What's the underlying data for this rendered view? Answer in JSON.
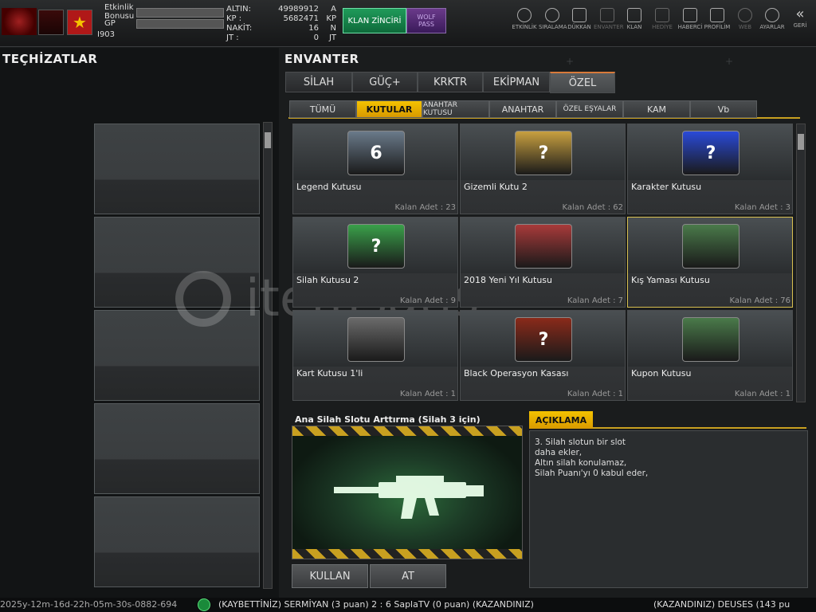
{
  "topbar": {
    "event_bonus": "Etkinlik\nBonusu",
    "gp": "GP",
    "level": "I903",
    "currencies": [
      {
        "label": "ALTIN:",
        "value": "49989912",
        "unit": "A"
      },
      {
        "label": "KP  :",
        "value": "5682471",
        "unit": "KP"
      },
      {
        "label": "NAKİT:",
        "value": "16",
        "unit": "N"
      },
      {
        "label": "JT  :",
        "value": "0",
        "unit": "JT"
      }
    ],
    "klan_button": "KLAN ZİNCİRİ",
    "wolf_pass": [
      "WOLF",
      "PASS"
    ],
    "nav": [
      {
        "label": "ETKİNLİK",
        "icon": "stopwatch-icon",
        "dim": false
      },
      {
        "label": "SIRALAMA",
        "icon": "medal-icon",
        "dim": false
      },
      {
        "label": "DÜKKAN",
        "icon": "cart-icon",
        "dim": false
      },
      {
        "label": "ENVANTER",
        "icon": "inventory-icon",
        "dim": true
      },
      {
        "label": "KLAN",
        "icon": "shield-icon",
        "dim": false
      },
      {
        "label": "HEDİYE",
        "icon": "gift-icon",
        "dim": true
      },
      {
        "label": "HABERCİ",
        "icon": "megaphone-icon",
        "dim": false
      },
      {
        "label": "PROFİLİM",
        "icon": "profile-icon",
        "dim": false
      },
      {
        "label": "WEB",
        "icon": "globe-icon",
        "dim": true
      },
      {
        "label": "AYARLAR",
        "icon": "gear-icon",
        "dim": false
      },
      {
        "label": "GERİ",
        "icon": "back-icon",
        "dim": false
      }
    ]
  },
  "left": {
    "title": "TEÇHİZATLAR"
  },
  "inventory": {
    "title": "ENVANTER",
    "tabs": [
      "SİLAH",
      "GÜÇ+",
      "KRKTR",
      "EKİPMAN",
      "ÖZEL"
    ],
    "active_tab": 4,
    "subtabs": [
      "TÜMÜ",
      "KUTULAR",
      "ANAHTAR KUTUSU",
      "ANAHTAR",
      "ÖZEL EŞYALAR",
      "KAM",
      "Vb"
    ],
    "active_subtab": 1,
    "items": [
      {
        "name": "Legend Kutusu",
        "qty": "Kalan Adet : 23",
        "color": "#6a7a8a",
        "badge": "6"
      },
      {
        "name": "Gizemli Kutu 2",
        "qty": "Kalan Adet : 62",
        "color": "#c8a040",
        "badge": "?"
      },
      {
        "name": "Karakter Kutusu",
        "qty": "Kalan Adet : 3",
        "color": "#2a4ad8",
        "badge": "?"
      },
      {
        "name": "Silah Kutusu 2",
        "qty": "Kalan Adet : 9",
        "color": "#3aa04a",
        "badge": "?"
      },
      {
        "name": "2018 Yeni Yıl Kutusu",
        "qty": "Kalan Adet : 7",
        "color": "#a83a3a",
        "badge": ""
      },
      {
        "name": "Kış Yaması Kutusu",
        "qty": "Kalan Adet : 76",
        "color": "#4a7a4a",
        "badge": ""
      },
      {
        "name": "Kart Kutusu 1'li",
        "qty": "Kalan Adet : 1",
        "color": "#6a6a6a",
        "badge": ""
      },
      {
        "name": "Black Operasyon Kasası",
        "qty": "Kalan Adet : 1",
        "color": "#8a2a1a",
        "badge": "?"
      },
      {
        "name": "Kupon Kutusu",
        "qty": "Kalan Adet : 1",
        "color": "#4a7a4a",
        "badge": ""
      }
    ],
    "selected_item": 5
  },
  "detail": {
    "title": "Ana Silah Slotu Arttırma (Silah 3 için)",
    "description_head": "AÇIKLAMA",
    "description": [
      "3. Silah slotun bir slot",
      "daha ekler,",
      "Altın silah konulamaz,",
      "Silah Puanı'yı 0 kabul eder,"
    ],
    "use_button": "KULLAN",
    "drop_button": "AT"
  },
  "ticker": {
    "left": "2025y-12m-16d-22h-05m-30s-0882-694",
    "middle": "(KAYBETTİNİZ) SERMİYAN (3 puan) 2 : 6 SaplaTV (0 puan) (KAZANDINIZ)",
    "right": "(KAZANDINIZ) DEUSES (143 pu"
  },
  "watermark": "itemsatış",
  "colors": {
    "accent": "#f4c200",
    "active_tab_line": "#d87a3a",
    "klan": "#1f9a5a",
    "wolf": "#6a3a8a"
  }
}
